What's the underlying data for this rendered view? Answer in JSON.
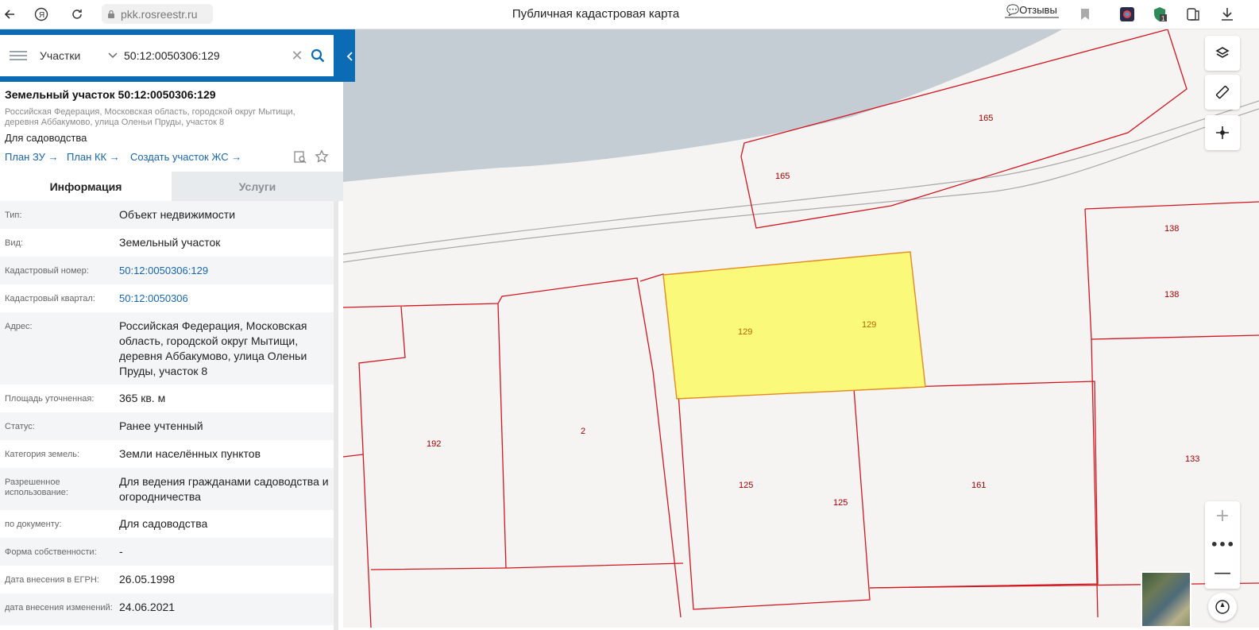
{
  "browser": {
    "url": "pkk.rosreestr.ru",
    "title": "Публичная кадастровая карта",
    "reviews_label": "Отзывы"
  },
  "search": {
    "category": "Участки",
    "value": "50:12:0050306:129"
  },
  "parcel": {
    "title": "Земельный участок 50:12:0050306:129",
    "address": "Российская Федерация, Московская область, городской округ Мытищи, деревня Аббакумово, улица Оленьи Пруды, участок 8",
    "purpose": "Для садоводства",
    "links": [
      "План ЗУ →",
      "План КК →",
      "Создать участок ЖС →"
    ]
  },
  "tabs": [
    "Информация",
    "Услуги"
  ],
  "attributes": [
    {
      "key": "Тип:",
      "value": "Объект недвижимости"
    },
    {
      "key": "Вид:",
      "value": "Земельный участок"
    },
    {
      "key": "Кадастровый номер:",
      "value": "50:12:0050306:129",
      "link": true
    },
    {
      "key": "Кадастровый квартал:",
      "value": "50:12:0050306",
      "link": true
    },
    {
      "key": "Адрес:",
      "value": "Российская Федерация, Московская область, городской округ Мытищи, деревня Аббакумово, улица Оленьи Пруды, участок 8"
    },
    {
      "key": "Площадь уточненная:",
      "value": "365 кв. м"
    },
    {
      "key": "Статус:",
      "value": "Ранее учтенный"
    },
    {
      "key": "Категория земель:",
      "value": "Земли населённых пунктов"
    },
    {
      "key": "Разрешенное использование:",
      "value": "Для ведения гражданами садоводства и огородничества"
    },
    {
      "key": "по документу:",
      "value": "Для садоводства"
    },
    {
      "key": "Форма собственности:",
      "value": "-"
    },
    {
      "key": "Дата внесения в ЕГРН:",
      "value": "26.05.1998"
    },
    {
      "key": "дата внесения изменений:",
      "value": "24.06.2021"
    }
  ],
  "map_labels": [
    "165",
    "165",
    "138",
    "138",
    "129",
    "129",
    "192",
    "2",
    "125",
    "125",
    "161",
    "133"
  ],
  "colors": {
    "accent": "#0b6bb5",
    "link": "#1766b0",
    "boundary": "#d2161e",
    "selected_fill": "#fbf97a",
    "water": "#c4cdd3"
  }
}
